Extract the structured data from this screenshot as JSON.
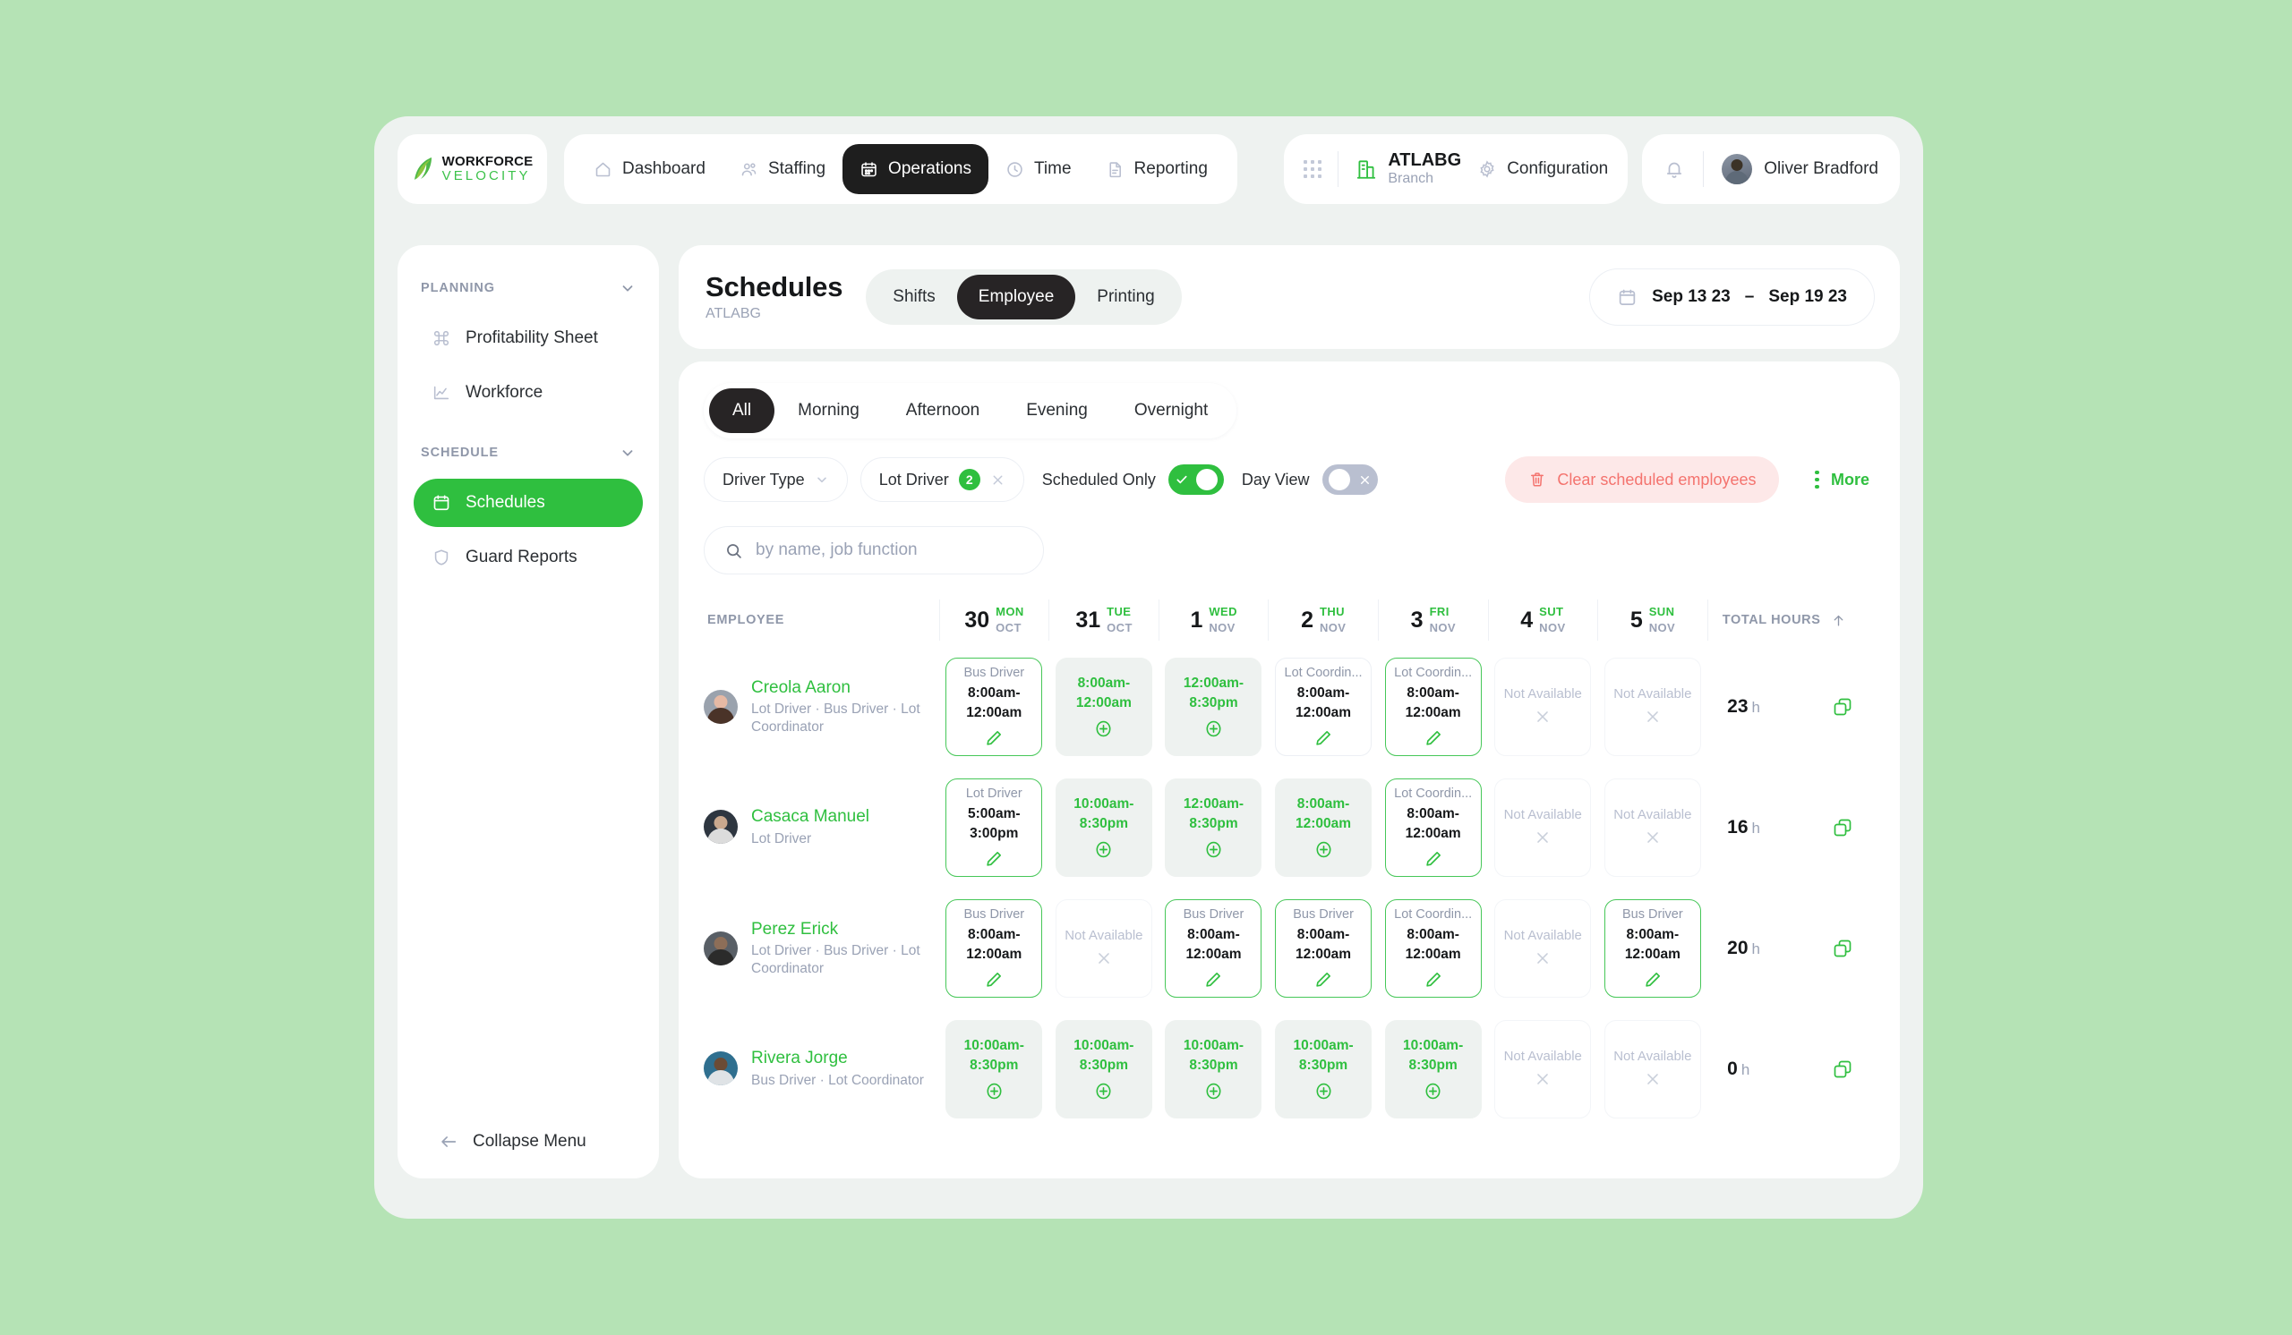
{
  "brand": {
    "line1": "WORKFORCE",
    "line2": "VELOCITY"
  },
  "nav": {
    "items": [
      {
        "label": "Dashboard",
        "icon": "home-icon",
        "active": false
      },
      {
        "label": "Staffing",
        "icon": "people-icon",
        "active": false
      },
      {
        "label": "Operations",
        "icon": "calendar-icon",
        "active": true
      },
      {
        "label": "Time",
        "icon": "clock-icon",
        "active": false
      },
      {
        "label": "Reporting",
        "icon": "document-icon",
        "active": false
      }
    ]
  },
  "topright": {
    "apps_icon": "grid-apps-icon",
    "branch_icon": "building-icon",
    "branch_name": "ATLABG",
    "branch_sub": "Branch",
    "configuration": "Configuration",
    "configuration_icon": "gear-icon",
    "bell_icon": "bell-icon",
    "user_name": "Oliver Bradford",
    "user_avatar": "avatar"
  },
  "sidebar": {
    "groups": [
      {
        "title": "PLANNING",
        "items": [
          {
            "label": "Profitability Sheet",
            "icon": "command-icon",
            "active": false
          },
          {
            "label": "Workforce",
            "icon": "line-chart-icon",
            "active": false
          }
        ]
      },
      {
        "title": "SCHEDULE",
        "items": [
          {
            "label": "Schedules",
            "icon": "calendar-icon",
            "active": true
          },
          {
            "label": "Guard Reports",
            "icon": "shield-icon",
            "active": false
          }
        ]
      }
    ],
    "collapse_label": "Collapse Menu",
    "collapse_icon": "arrow-left-icon"
  },
  "header": {
    "title": "Schedules",
    "subtitle": "ATLABG",
    "view_tabs": [
      {
        "label": "Shifts",
        "active": false
      },
      {
        "label": "Employee",
        "active": true
      },
      {
        "label": "Printing",
        "active": false
      }
    ],
    "daterange": {
      "icon": "calendar-icon",
      "start": "Sep 13 23",
      "dash": "–",
      "end": "Sep 19 23"
    }
  },
  "shift_tabs": [
    {
      "label": "All",
      "active": true
    },
    {
      "label": "Morning",
      "active": false
    },
    {
      "label": "Afternoon",
      "active": false
    },
    {
      "label": "Evening",
      "active": false
    },
    {
      "label": "Overnight",
      "active": false
    }
  ],
  "filters": {
    "driver_type": {
      "label": "Driver Type",
      "icon": "chevron-down-icon"
    },
    "lot_driver": {
      "label": "Lot Driver",
      "count": "2",
      "remove_icon": "close-icon"
    },
    "scheduled_only": {
      "label": "Scheduled Only",
      "state": "on"
    },
    "day_view": {
      "label": "Day View",
      "state": "off"
    },
    "clear_button": {
      "label": "Clear scheduled employees",
      "icon": "trash-icon",
      "color": "#f4736e"
    },
    "more_button": {
      "label": "More",
      "icon": "kebab-icon",
      "color": "#2fbf3f"
    }
  },
  "search": {
    "placeholder": "by name, job function",
    "value": "",
    "icon": "search-icon"
  },
  "table": {
    "header": {
      "employee": "EMPLOYEE",
      "total_hours": "TOTAL HOURS",
      "sort_icon": "arrow-up-icon",
      "days": [
        {
          "num": "30",
          "dow": "MON",
          "mon": "OCT"
        },
        {
          "num": "31",
          "dow": "TUE",
          "mon": "OCT"
        },
        {
          "num": "1",
          "dow": "WED",
          "mon": "NOV"
        },
        {
          "num": "2",
          "dow": "THU",
          "mon": "NOV"
        },
        {
          "num": "3",
          "dow": "FRI",
          "mon": "NOV"
        },
        {
          "num": "4",
          "dow": "SUT",
          "mon": "NOV"
        },
        {
          "num": "5",
          "dow": "SUN",
          "mon": "NOV"
        }
      ]
    },
    "rows": [
      {
        "name": "Creola Aaron",
        "roles": "Lot Driver · Bus Driver · Lot Coordinator",
        "avatar_skin": "#e6b9a4",
        "avatar_hair": "#4a3328",
        "avatar_bg": "#9aa2ad",
        "total": "23",
        "total_unit": "h",
        "copy_icon": "copy-icon",
        "cells": [
          {
            "type": "sched-on",
            "role": "Bus Driver",
            "time": "8:00am-12:00am",
            "icon": "pencil-icon"
          },
          {
            "type": "avail",
            "role": "",
            "time": "8:00am-12:00am",
            "icon": "plus-circle-icon"
          },
          {
            "type": "avail",
            "role": "",
            "time": "12:00am-8:30pm",
            "icon": "plus-circle-icon"
          },
          {
            "type": "sched-off",
            "role": "Lot Coordin...",
            "time": "8:00am-12:00am",
            "icon": "pencil-icon"
          },
          {
            "type": "sched-on",
            "role": "Lot Coordin...",
            "time": "8:00am-12:00am",
            "icon": "pencil-icon"
          },
          {
            "type": "na",
            "role": "",
            "time": "Not Available",
            "icon": "close-icon"
          },
          {
            "type": "na",
            "role": "",
            "time": "Not Available",
            "icon": "close-icon"
          }
        ]
      },
      {
        "name": "Casaca Manuel",
        "roles": "Lot Driver",
        "avatar_skin": "#c9a88e",
        "avatar_hair": "#dcdcdc",
        "avatar_bg": "#2e3640",
        "total": "16",
        "total_unit": "h",
        "copy_icon": "copy-icon",
        "cells": [
          {
            "type": "sched-on",
            "role": "Lot Driver",
            "time": "5:00am-3:00pm",
            "icon": "pencil-icon"
          },
          {
            "type": "avail",
            "role": "",
            "time": "10:00am-8:30pm",
            "icon": "plus-circle-icon"
          },
          {
            "type": "avail",
            "role": "",
            "time": "12:00am-8:30pm",
            "icon": "plus-circle-icon"
          },
          {
            "type": "avail",
            "role": "",
            "time": "8:00am-12:00am",
            "icon": "plus-circle-icon"
          },
          {
            "type": "sched-on",
            "role": "Lot Coordin...",
            "time": "8:00am-12:00am",
            "icon": "pencil-icon"
          },
          {
            "type": "na",
            "role": "",
            "time": "Not Available",
            "icon": "close-icon"
          },
          {
            "type": "na",
            "role": "",
            "time": "Not Available",
            "icon": "close-icon"
          }
        ]
      },
      {
        "name": "Perez Erick",
        "roles": "Lot Driver · Bus Driver · Lot Coordinator",
        "avatar_skin": "#8d6e58",
        "avatar_hair": "#2b2b2b",
        "avatar_bg": "#595f66",
        "total": "20",
        "total_unit": "h",
        "copy_icon": "copy-icon",
        "cells": [
          {
            "type": "sched-on",
            "role": "Bus Driver",
            "time": "8:00am-12:00am",
            "icon": "pencil-icon"
          },
          {
            "type": "na",
            "role": "",
            "time": "Not Available",
            "icon": "close-icon"
          },
          {
            "type": "sched-on",
            "role": "Bus Driver",
            "time": "8:00am-12:00am",
            "icon": "pencil-icon"
          },
          {
            "type": "sched-on",
            "role": "Bus Driver",
            "time": "8:00am-12:00am",
            "icon": "pencil-icon"
          },
          {
            "type": "sched-on",
            "role": "Lot Coordin...",
            "time": "8:00am-12:00am",
            "icon": "pencil-icon"
          },
          {
            "type": "na",
            "role": "",
            "time": "Not Available",
            "icon": "close-icon"
          },
          {
            "type": "sched-on",
            "role": "Bus Driver",
            "time": "8:00am-12:00am",
            "icon": "pencil-icon"
          }
        ]
      },
      {
        "name": "Rivera Jorge",
        "roles": "Bus Driver · Lot Coordinator",
        "avatar_skin": "#6b4b35",
        "avatar_hair": "#dfe3e6",
        "avatar_bg": "#2f6f8f",
        "total": "0",
        "total_unit": "h",
        "copy_icon": "copy-icon",
        "cells": [
          {
            "type": "avail",
            "role": "",
            "time": "10:00am-8:30pm",
            "icon": "plus-circle-icon"
          },
          {
            "type": "avail",
            "role": "",
            "time": "10:00am-8:30pm",
            "icon": "plus-circle-icon"
          },
          {
            "type": "avail",
            "role": "",
            "time": "10:00am-8:30pm",
            "icon": "plus-circle-icon"
          },
          {
            "type": "avail",
            "role": "",
            "time": "10:00am-8:30pm",
            "icon": "plus-circle-icon"
          },
          {
            "type": "avail",
            "role": "",
            "time": "10:00am-8:30pm",
            "icon": "plus-circle-icon"
          },
          {
            "type": "na",
            "role": "",
            "time": "Not Available",
            "icon": "close-icon"
          },
          {
            "type": "na",
            "role": "",
            "time": "Not Available",
            "icon": "close-icon"
          }
        ]
      }
    ]
  },
  "colors": {
    "accent_green": "#2fbf3f",
    "dark": "#1e1e1e",
    "danger": "#f4736e",
    "muted": "#9aa2b5",
    "page_bg": "#b5e3b5"
  }
}
